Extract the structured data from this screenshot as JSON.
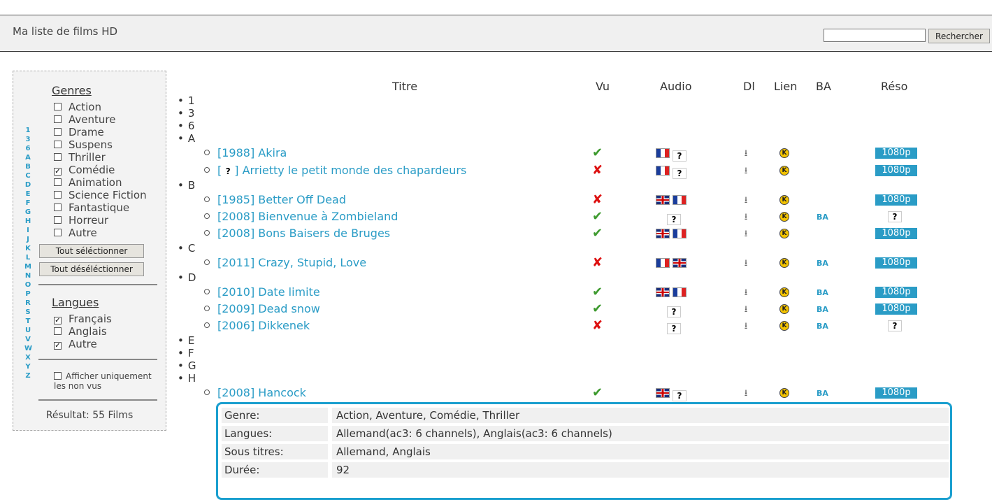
{
  "header": {
    "title": "Ma liste de films HD",
    "search_value": "",
    "search_button": "Rechercher"
  },
  "sidebar": {
    "alphabet": [
      "1",
      "3",
      "6",
      "A",
      "B",
      "C",
      "D",
      "E",
      "F",
      "G",
      "H",
      "I",
      "J",
      "K",
      "L",
      "M",
      "N",
      "O",
      "P",
      "R",
      "S",
      "T",
      "U",
      "V",
      "W",
      "X",
      "Y",
      "Z"
    ],
    "genres_title": "Genres",
    "genres": [
      {
        "label": "Action",
        "checked": false
      },
      {
        "label": "Aventure",
        "checked": false
      },
      {
        "label": "Drame",
        "checked": false
      },
      {
        "label": "Suspens",
        "checked": false
      },
      {
        "label": "Thriller",
        "checked": false
      },
      {
        "label": "Comédie",
        "checked": true
      },
      {
        "label": "Animation",
        "checked": false
      },
      {
        "label": "Science Fiction",
        "checked": false
      },
      {
        "label": "Fantastique",
        "checked": false
      },
      {
        "label": "Horreur",
        "checked": false
      },
      {
        "label": "Autre",
        "checked": false
      }
    ],
    "select_all": "Tout séléctionner",
    "deselect_all": "Tout déséléctionner",
    "langues_title": "Langues",
    "langues": [
      {
        "label": "Français",
        "checked": true
      },
      {
        "label": "Anglais",
        "checked": false
      },
      {
        "label": "Autre",
        "checked": true
      }
    ],
    "unseen_line1": "Afficher uniquement",
    "unseen_line2": "les non vus",
    "unseen_checked": false,
    "result": "Résultat: 55 Films"
  },
  "table": {
    "headers": {
      "titre": "Titre",
      "vu": "Vu",
      "audio": "Audio",
      "dl": "Dl",
      "lien": "Lien",
      "ba": "BA",
      "reso": "Réso"
    },
    "letters": [
      "1",
      "3",
      "6",
      "A",
      "B",
      "C",
      "D",
      "E",
      "F",
      "G",
      "H"
    ],
    "films": [
      {
        "title": "[1988] Akira",
        "vu": true,
        "audio": [
          "fr",
          "?"
        ],
        "ba": "",
        "reso": "1080p"
      },
      {
        "title_pre": "[",
        "title_post": "] Arrietty le petit monde des chapardeurs",
        "vu": false,
        "audio": [
          "fr",
          "?"
        ],
        "ba": "",
        "reso": "1080p"
      },
      {
        "title": "[1985] Better Off Dead",
        "vu": false,
        "audio": [
          "uk",
          "fr"
        ],
        "ba": "",
        "reso": "1080p"
      },
      {
        "title": "[2008] Bienvenue à Zombieland",
        "vu": true,
        "audio": [
          "?"
        ],
        "ba": "BA",
        "reso": "?"
      },
      {
        "title": "[2008] Bons Baisers de Bruges",
        "vu": true,
        "audio": [
          "uk",
          "fr"
        ],
        "ba": "",
        "reso": "1080p"
      },
      {
        "title": "[2011] Crazy, Stupid, Love",
        "vu": false,
        "audio": [
          "fr",
          "uk"
        ],
        "ba": "BA",
        "reso": "1080p"
      },
      {
        "title": "[2010] Date limite",
        "vu": true,
        "audio": [
          "uk",
          "fr"
        ],
        "ba": "BA",
        "reso": "1080p"
      },
      {
        "title": "[2009] Dead snow",
        "vu": true,
        "audio": [
          "?"
        ],
        "ba": "BA",
        "reso": "1080p"
      },
      {
        "title": "[2006] Dikkenek",
        "vu": false,
        "audio": [
          "?"
        ],
        "ba": "BA",
        "reso": "?"
      },
      {
        "title": "[2008] Hancock",
        "vu": true,
        "audio": [
          "uk",
          "?"
        ],
        "ba": "BA",
        "reso": "1080p"
      }
    ]
  },
  "detail": {
    "rows": [
      {
        "label": "Genre:",
        "value": "Action, Aventure, Comédie, Thriller"
      },
      {
        "label": "Langues:",
        "value": "Allemand(ac3: 6 channels), Anglais(ac3: 6 channels)"
      },
      {
        "label": "Sous titres:",
        "value": "Allemand, Anglais"
      },
      {
        "label": "Durée:",
        "value": "92"
      }
    ]
  },
  "colors": {
    "accent": "#2a9cc6",
    "seen": "#3d9a2e",
    "unseen": "#dd1111",
    "detail_border": "#1a9fcf"
  },
  "icons": {
    "vu_yes": "checkmark-icon",
    "vu_no": "cross-icon",
    "dl": "download-icon",
    "lien": "link-icon",
    "unknown": "question-mark-icon"
  }
}
